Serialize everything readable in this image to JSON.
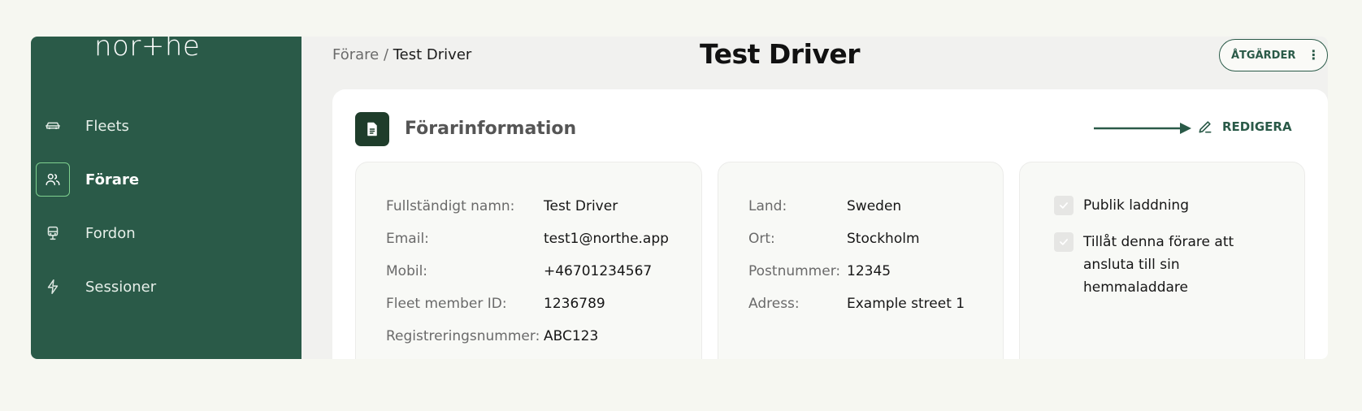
{
  "sidebar": {
    "logo": "nor+he",
    "items": [
      {
        "label": "Fleets",
        "icon": "car-icon",
        "active": false
      },
      {
        "label": "Förare",
        "icon": "users-icon",
        "active": true
      },
      {
        "label": "Fordon",
        "icon": "vehicle-icon",
        "active": false
      },
      {
        "label": "Sessioner",
        "icon": "lightning-icon",
        "active": false
      }
    ]
  },
  "header": {
    "breadcrumb_parent": "Förare",
    "breadcrumb_separator": " / ",
    "breadcrumb_current": "Test Driver",
    "title": "Test Driver",
    "actions_label": "ÅTGÄRDER"
  },
  "card": {
    "title": "Förarinformation",
    "edit_label": "REDIGERA"
  },
  "personal": {
    "rows": [
      {
        "label": "Fullständigt namn:",
        "value": "Test Driver"
      },
      {
        "label": "Email:",
        "value": "test1@northe.app"
      },
      {
        "label": "Mobil:",
        "value": "+46701234567"
      },
      {
        "label": "Fleet member ID:",
        "value": "1236789"
      },
      {
        "label": "Registreringsnummer:",
        "value": "ABC123"
      }
    ]
  },
  "address": {
    "rows": [
      {
        "label": "Land:",
        "value": "Sweden"
      },
      {
        "label": "Ort:",
        "value": "Stockholm"
      },
      {
        "label": "Postnummer:",
        "value": "12345"
      },
      {
        "label": "Adress:",
        "value": "Example street 1"
      }
    ]
  },
  "permissions": {
    "items": [
      {
        "label": "Publik laddning",
        "checked": true
      },
      {
        "label": "Tillåt denna förare att ansluta till sin hemmaladdare",
        "checked": true
      }
    ]
  },
  "colors": {
    "brand_green": "#2a5a48",
    "active_border": "#7ed08f",
    "card_icon_bg": "#1f3d2b",
    "page_bg": "#f6f7f1"
  }
}
